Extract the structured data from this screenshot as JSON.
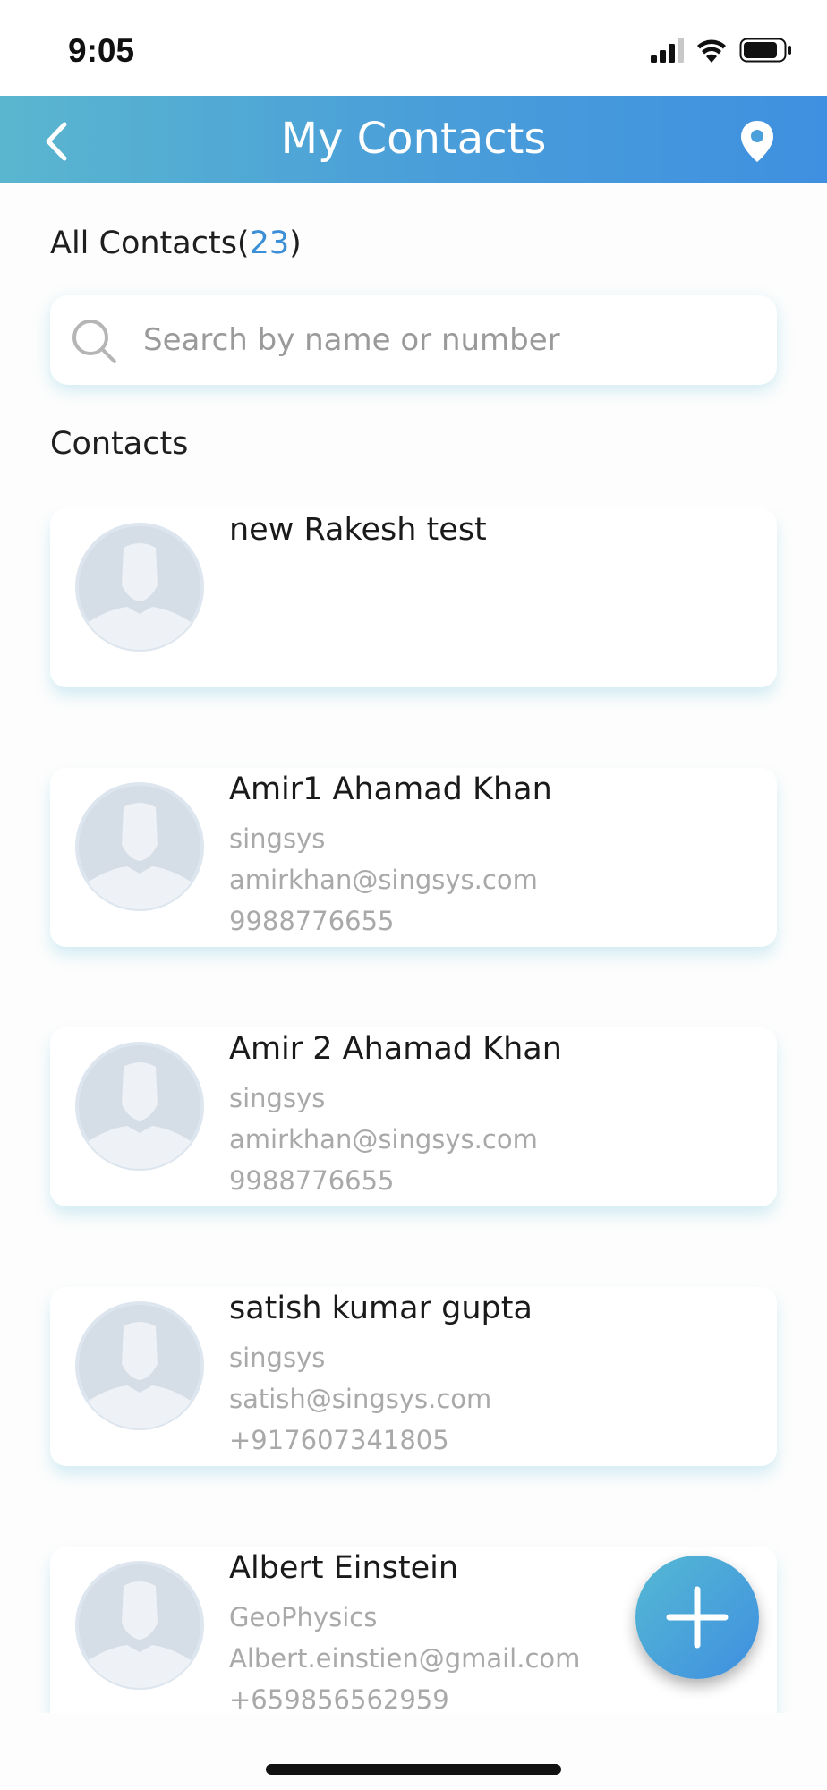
{
  "status_bar": {
    "time": "9:05"
  },
  "header": {
    "title": "My Contacts"
  },
  "summary": {
    "label_prefix": "All Contacts(",
    "count": "23",
    "label_suffix": ")"
  },
  "search": {
    "placeholder": "Search by name or number"
  },
  "section_label": "Contacts",
  "contacts": [
    {
      "name": "new Rakesh test",
      "company": "",
      "email": "",
      "phone": ""
    },
    {
      "name": "Amir1 Ahamad Khan",
      "company": "singsys",
      "email": "amirkhan@singsys.com",
      "phone": "9988776655"
    },
    {
      "name": "Amir 2 Ahamad Khan",
      "company": "singsys",
      "email": "amirkhan@singsys.com",
      "phone": "9988776655"
    },
    {
      "name": "satish kumar gupta",
      "company": "singsys",
      "email": "satish@singsys.com",
      "phone": "+917607341805"
    },
    {
      "name": "Albert Einstein",
      "company": "GeoPhysics",
      "email": "Albert.einstien@gmail.com",
      "phone": "+659856562959"
    }
  ],
  "icons": {
    "back": "chevron-left-icon",
    "location": "location-pin-icon",
    "search": "search-icon",
    "avatar": "user-placeholder-icon",
    "add": "plus-icon"
  },
  "colors": {
    "header_gradient_start": "#5ab6cf",
    "header_gradient_end": "#3f90e0",
    "count_accent": "#3a8fd6",
    "fab": "#4a9fd9"
  }
}
